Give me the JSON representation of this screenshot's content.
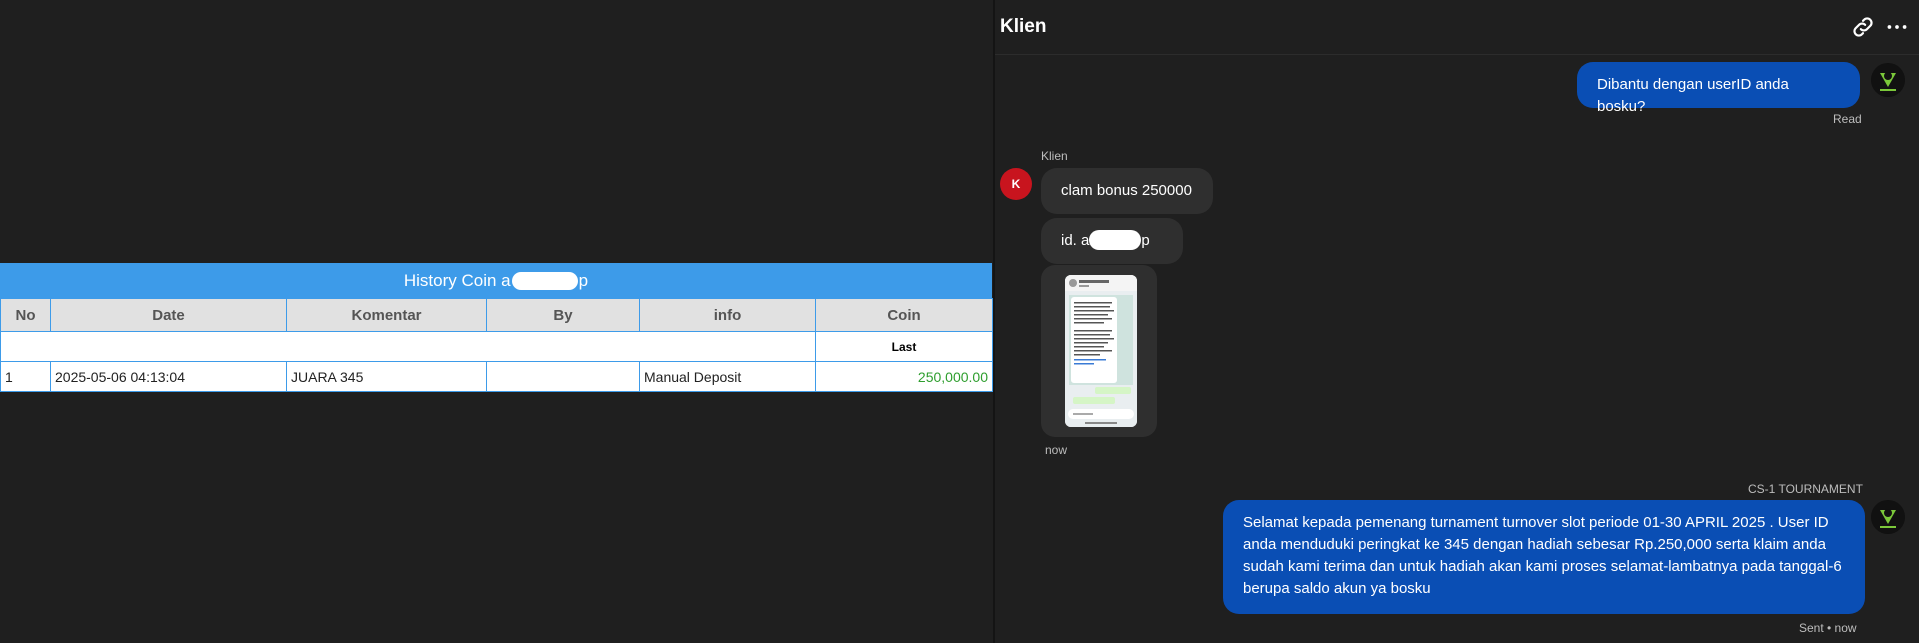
{
  "history": {
    "title_prefix": "History Coin a",
    "title_suffix": "p",
    "columns": [
      "No",
      "Date",
      "Komentar",
      "By",
      "info",
      "Coin"
    ],
    "sub_header": "Last",
    "rows": [
      {
        "no": "1",
        "date": "2025-05-06 04:13:04",
        "komentar": "JUARA 345",
        "by": "",
        "info": "Manual Deposit",
        "coin": "250,000.00"
      }
    ]
  },
  "chat": {
    "title": "Klien",
    "icons": [
      "link-icon",
      "more-options-icon"
    ],
    "messages": [
      {
        "direction": "out",
        "text": "Dibantu dengan userID anda bosku?",
        "status": "Read"
      },
      {
        "direction": "in",
        "sender": "Klien",
        "avatar_initial": "K",
        "text": "clam bonus 250000"
      },
      {
        "direction": "in",
        "text_prefix": "id. a",
        "text_suffix": "p"
      },
      {
        "direction": "in",
        "type": "image",
        "time": "now"
      },
      {
        "direction": "out",
        "sender": "CS-1 TOURNAMENT",
        "text": "Selamat kepada pemenang turnament turnover slot periode 01-30 APRIL 2025 . User ID anda menduduki peringkat ke 345 dengan hadiah sebesar Rp.250,000 serta klaim anda sudah kami terima dan untuk hadiah akan kami proses selamat-lambatnya pada tanggal-6 berupa saldo akun ya bosku",
        "status": "Sent • now"
      }
    ]
  },
  "colors": {
    "page_bg": "#1f1f1f",
    "table_header_blue": "#3d9be9",
    "outgoing_bubble": "#0a4eb4",
    "incoming_bubble": "#2f2f2f",
    "avatar_red": "#c8141e",
    "coin_green": "#2e9e2e"
  }
}
